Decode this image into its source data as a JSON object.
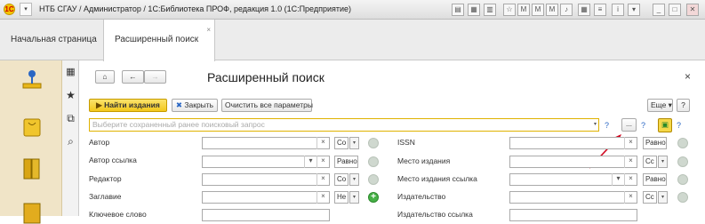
{
  "window": {
    "title": "НТБ СГАУ / Администратор / 1С:Библиотека ПРОФ, редакция 1.0  (1С:Предприятие)",
    "app_icon": "1c-logo-icon"
  },
  "tabs": [
    {
      "label": "Начальная страница"
    },
    {
      "label": "Расширенный поиск"
    }
  ],
  "form": {
    "title": "Расширенный поиск",
    "toolbar": {
      "find_label": "Найти издания",
      "close_label": "Закрыть",
      "clear_label": "Очистить все параметры",
      "more_label": "Еще",
      "help_label": "?"
    },
    "saved_search_placeholder": "Выберите сохраненный ранее поисковый запрос",
    "ellipsis_label": "...",
    "help_mark": "?"
  },
  "left_fields": [
    {
      "label": "Автор",
      "condition": "Со"
    },
    {
      "label": "Автор ссылка",
      "condition": "Равно"
    },
    {
      "label": "Редактор",
      "condition": "Со"
    },
    {
      "label": "Заглавие",
      "condition": "Не"
    },
    {
      "label": "Ключевое слово",
      "condition": ""
    }
  ],
  "right_fields": [
    {
      "label": "ISSN",
      "condition": "Равно"
    },
    {
      "label": "Место издания",
      "condition": "Сс"
    },
    {
      "label": "Место издания ссылка",
      "condition": "Равно"
    },
    {
      "label": "Издательство",
      "condition": "Сс"
    },
    {
      "label": "Издательство ссылка",
      "condition": ""
    }
  ],
  "colors": {
    "accent": "#f3c81c",
    "left_panel": "#f0e4c7",
    "annotation_arrow": "#d0021b"
  }
}
